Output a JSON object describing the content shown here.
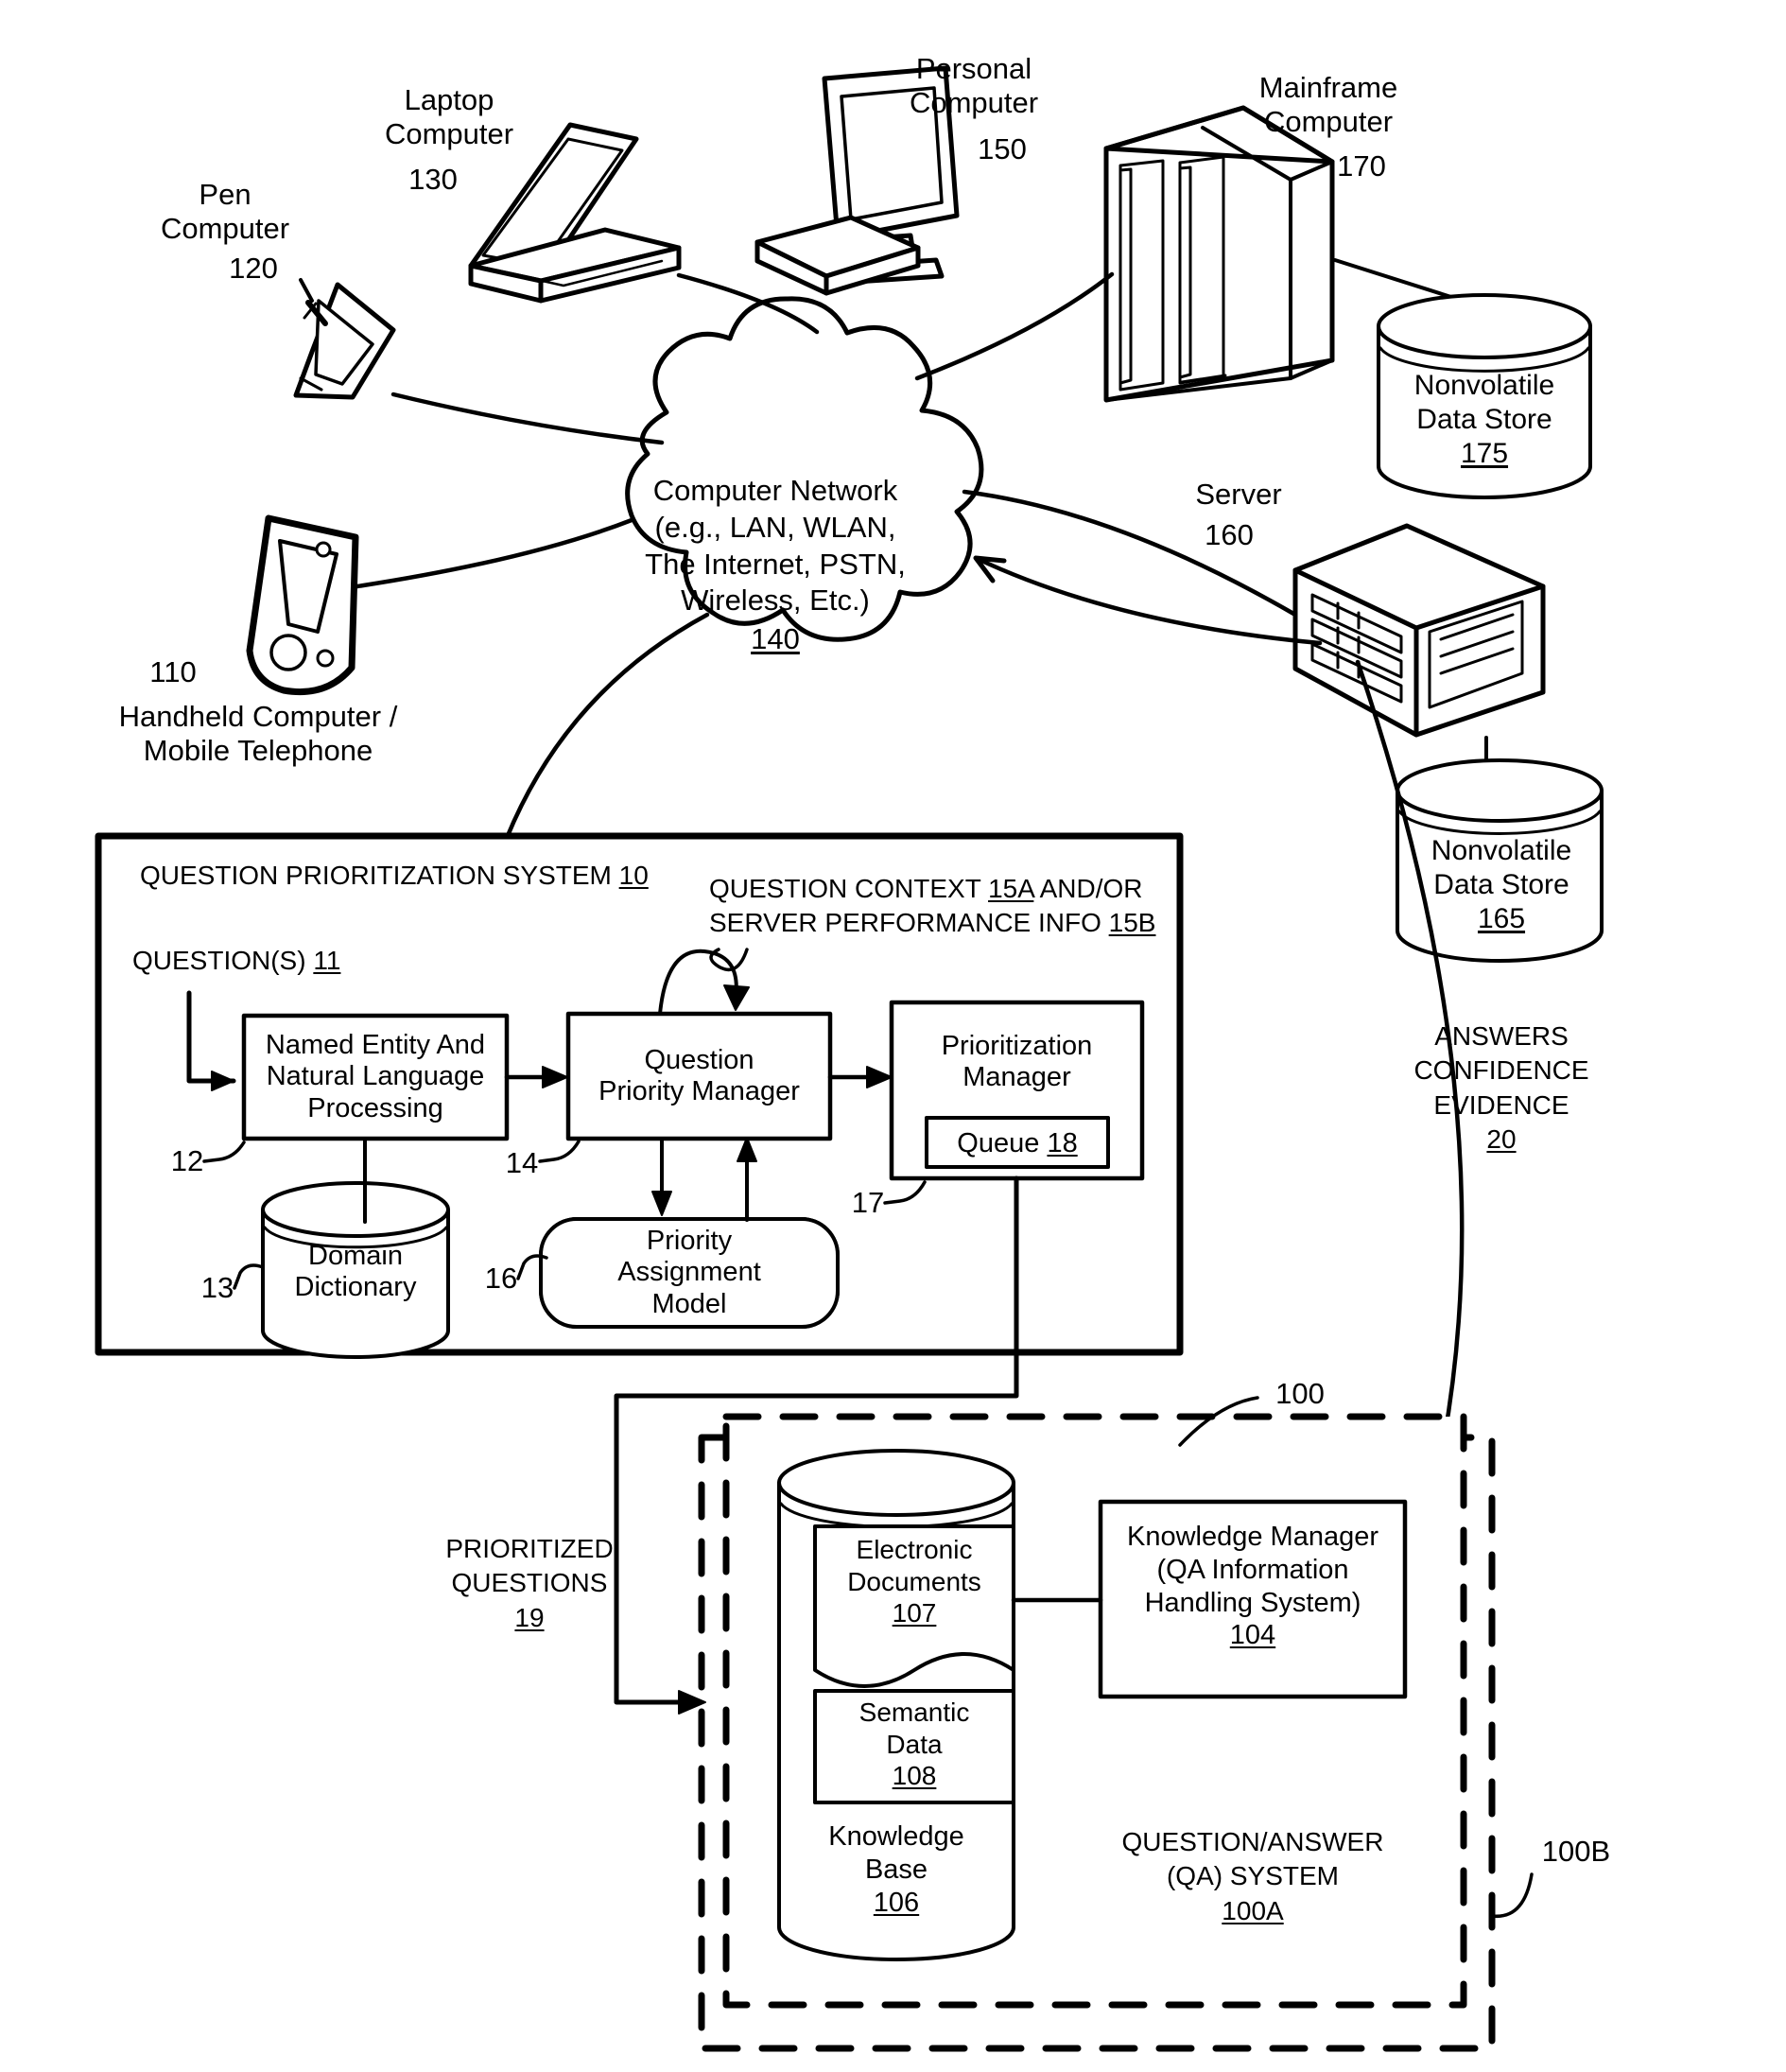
{
  "figure": {
    "title": "Question Prioritization System with Question/Answer System over a Computer Network",
    "type": "patent-block-diagram"
  },
  "devices": [
    {
      "name": "pen-computer",
      "label": "Pen\nComputer",
      "ref": "120"
    },
    {
      "name": "laptop-computer",
      "label": "Laptop\nComputer",
      "ref": "130"
    },
    {
      "name": "personal-computer",
      "label": "Personal\nComputer",
      "ref": "150"
    },
    {
      "name": "mainframe-computer",
      "label": "Mainframe\nComputer",
      "ref": "170"
    },
    {
      "name": "handheld-computer",
      "label": "Handheld Computer /\nMobile Telephone",
      "ref": "110"
    },
    {
      "name": "server",
      "label": "Server",
      "ref": "160"
    }
  ],
  "network": {
    "lines": [
      "Computer Network",
      "(e.g., LAN, WLAN,",
      "The Internet, PSTN,",
      "Wireless, Etc.)"
    ],
    "ref": "140"
  },
  "data_stores": [
    {
      "name": "nonvolatile-data-store-175",
      "lines": [
        "Nonvolatile",
        "Data Store"
      ],
      "ref": "175"
    },
    {
      "name": "nonvolatile-data-store-165",
      "lines": [
        "Nonvolatile",
        "Data Store"
      ],
      "ref": "165"
    }
  ],
  "qps": {
    "title": "QUESTION PRIORITIZATION SYSTEM",
    "title_ref": "10",
    "questions_label": "QUESTION(S)",
    "questions_ref": "11",
    "context_line1_pre": "QUESTION CONTEXT ",
    "context_line1_ref": "15A",
    "context_line1_post": " AND/OR",
    "context_line2_pre": "SERVER PERFORMANCE INFO ",
    "context_line2_ref": "15B",
    "blocks": [
      {
        "name": "named-entity-nlp-block",
        "lines": [
          "Named Entity And",
          "Natural Language",
          "Processing"
        ],
        "ref": "12"
      },
      {
        "name": "question-priority-manager-block",
        "lines": [
          "Question",
          "Priority Manager"
        ],
        "ref": "14"
      },
      {
        "name": "prioritization-manager-block",
        "lines": [
          "Prioritization",
          "Manager"
        ],
        "ref": "17"
      },
      {
        "name": "domain-dictionary-store",
        "lines": [
          "Domain",
          "Dictionary"
        ],
        "ref": "13"
      },
      {
        "name": "priority-assignment-model-block",
        "lines": [
          "Priority",
          "Assignment",
          "Model"
        ],
        "ref": "16"
      }
    ],
    "queue": {
      "label": "Queue",
      "ref": "18"
    }
  },
  "flows": {
    "prioritized_questions": {
      "lines": [
        "PRIORITIZED",
        "QUESTIONS"
      ],
      "ref": "19"
    },
    "answers_confidence": {
      "lines": [
        "ANSWERS",
        "CONFIDENCE",
        "EVIDENCE"
      ],
      "ref": "20"
    }
  },
  "qa_system": {
    "outer_ref": "100B",
    "inner_ref": "100",
    "title_lines": [
      "QUESTION/ANSWER",
      "(QA) SYSTEM"
    ],
    "title_ref": "100A",
    "knowledge_base": {
      "lines": [
        "Knowledge",
        "Base"
      ],
      "ref": "106"
    },
    "electronic_documents": {
      "lines": [
        "Electronic",
        "Documents"
      ],
      "ref": "107"
    },
    "semantic_data": {
      "lines": [
        "Semantic",
        "Data"
      ],
      "ref": "108"
    },
    "knowledge_manager": {
      "lines": [
        "Knowledge Manager",
        "(QA Information",
        "Handling System)"
      ],
      "ref": "104"
    }
  },
  "colors": {
    "ink": "#000000",
    "paper": "#ffffff"
  }
}
